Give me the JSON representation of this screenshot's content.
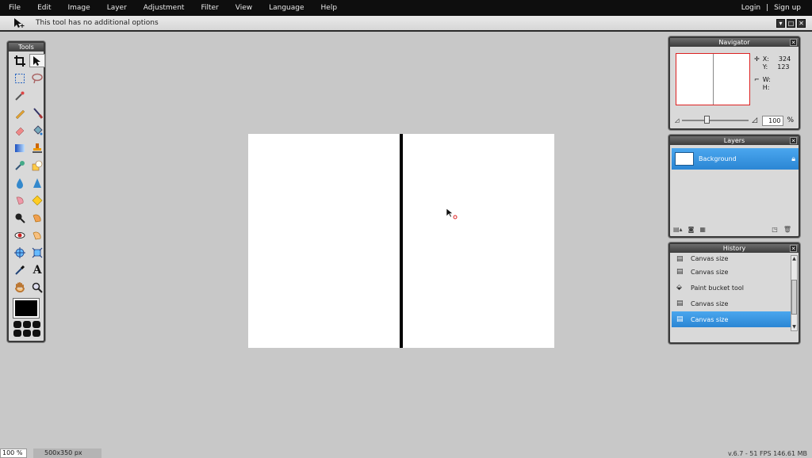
{
  "menu": {
    "items": [
      "File",
      "Edit",
      "Image",
      "Layer",
      "Adjustment",
      "Filter",
      "View",
      "Language",
      "Help"
    ],
    "login": "Login",
    "separator": "|",
    "signup": "Sign up"
  },
  "options": {
    "message": "This tool has no additional options"
  },
  "tools": {
    "title": "Tools"
  },
  "navigator": {
    "title": "Navigator",
    "x_label": "X:",
    "x_value": "324",
    "y_label": "Y:",
    "y_value": "123",
    "w_label": "W:",
    "h_label": "H:",
    "zoom_value": "100",
    "zoom_unit": "%"
  },
  "layers": {
    "title": "Layers",
    "items": [
      {
        "name": "Background"
      }
    ]
  },
  "history": {
    "title": "History",
    "items": [
      {
        "label": "Canvas size",
        "icon": "canvas-size-icon"
      },
      {
        "label": "Canvas size",
        "icon": "canvas-size-icon"
      },
      {
        "label": "Paint bucket tool",
        "icon": "paint-bucket-icon"
      },
      {
        "label": "Canvas size",
        "icon": "canvas-size-icon"
      },
      {
        "label": "Canvas size",
        "icon": "canvas-size-icon"
      }
    ],
    "selected_index": 4
  },
  "status": {
    "zoom": "100",
    "zoom_unit": "%",
    "dimensions": "500x350 px",
    "version": "v.6.7 - 51 FPS 146.61 MB"
  },
  "colors": {
    "accent": "#2b86d4",
    "foreground": "#000000"
  }
}
